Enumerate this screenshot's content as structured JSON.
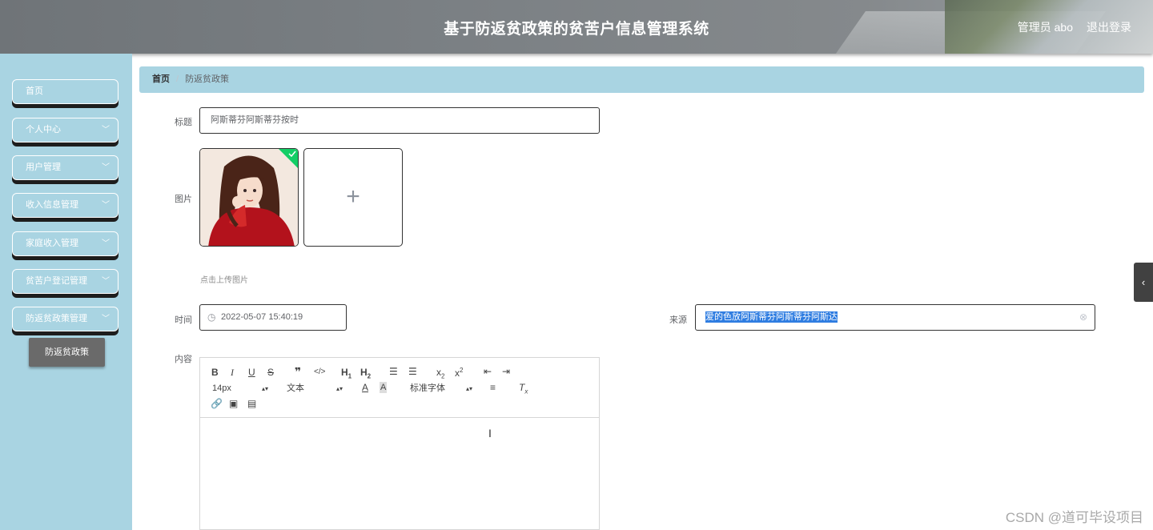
{
  "header": {
    "title": "基于防返贫政策的贫苦户信息管理系统",
    "user": "管理员 abo",
    "logout": "退出登录"
  },
  "sidebar": {
    "items": [
      {
        "label": "首页",
        "has_arrow": false
      },
      {
        "label": "个人中心",
        "has_arrow": true
      },
      {
        "label": "用户管理",
        "has_arrow": true
      },
      {
        "label": "收入信息管理",
        "has_arrow": true
      },
      {
        "label": "家庭收入管理",
        "has_arrow": true
      },
      {
        "label": "贫苦户登记管理",
        "has_arrow": true
      },
      {
        "label": "防返贫政策管理",
        "has_arrow": true
      }
    ],
    "sub_item": "防返贫政策"
  },
  "breadcrumb": {
    "home": "首页",
    "separator": "/",
    "current": "防返贫政策"
  },
  "form": {
    "title_label": "标题",
    "title_value": "阿斯蒂芬阿斯蒂芬按时",
    "image_label": "图片",
    "upload_tip": "点击上传图片",
    "time_label": "时间",
    "time_value": "2022-05-07 15:40:19",
    "source_label": "来源",
    "source_value": "爱的色放阿斯蒂芬阿斯蒂芬阿斯达",
    "content_label": "内容"
  },
  "editor": {
    "font_size": "14px",
    "heading": "文本",
    "font_family": "标准字体"
  },
  "icons": {
    "date": "clock-icon",
    "clear": "circle-close-icon",
    "plus": "plus-icon",
    "toggle": "chevron-left-icon"
  },
  "colors": {
    "sidebar": "#a9d4e2",
    "breadcrumb": "#a9d4e2",
    "sub_item": "#6a6a6a",
    "upload_success": "#13ce66",
    "selection": "#2f7de1"
  },
  "watermark": "CSDN @道可毕设项目"
}
